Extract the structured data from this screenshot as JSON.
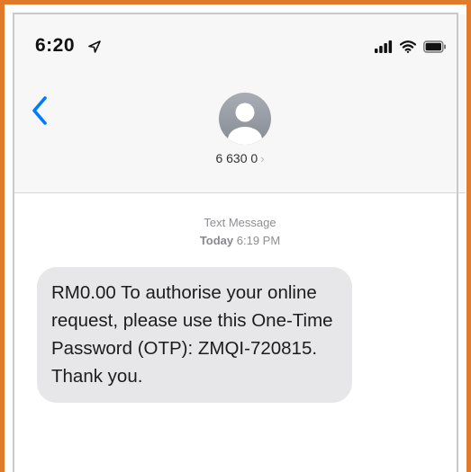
{
  "status_bar": {
    "time": "6:20",
    "icons": [
      "location-arrow-icon",
      "signal-bars-icon",
      "wifi-icon",
      "battery-icon"
    ]
  },
  "header": {
    "back_icon": "chevron-left-icon",
    "avatar_icon": "person-icon",
    "contact": "6 630 0",
    "contact_chevron": "›"
  },
  "thread": {
    "type_label": "Text Message",
    "day": "Today",
    "time": "6:19 PM",
    "messages": [
      {
        "text": "RM0.00 To authorise your online request, please use this One-Time Password (OTP): ZMQI-720815. Thank you."
      }
    ]
  },
  "colors": {
    "frame": "#e07b2c",
    "accent": "#007aff",
    "bubble": "#e7e7ea"
  }
}
